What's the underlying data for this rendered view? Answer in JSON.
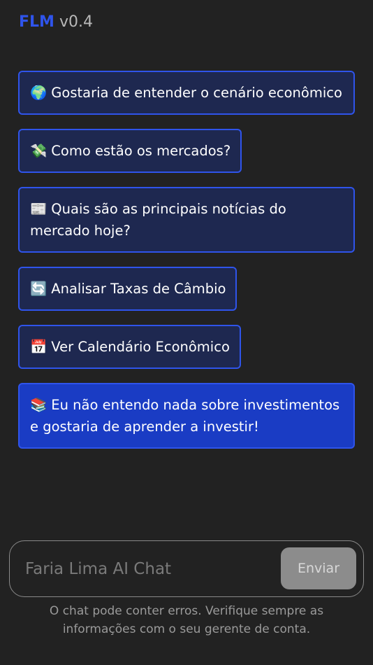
{
  "header": {
    "brand": "FLM",
    "version": "v0.4"
  },
  "suggestions": [
    {
      "emoji": "🌍",
      "label": "Gostaria de entender o cenário econômico"
    },
    {
      "emoji": "💸",
      "label": "Como estão os mercados?"
    },
    {
      "emoji": "📰",
      "label": "Quais são as principais notícias do mercado hoje?"
    },
    {
      "emoji": "🔄",
      "label": "Analisar Taxas de Câmbio"
    },
    {
      "emoji": "📅",
      "label": "Ver Calendário Econômico"
    },
    {
      "emoji": "📚",
      "label": "Eu não entendo nada sobre investimentos e gostaria de aprender a investir!"
    }
  ],
  "chat": {
    "placeholder": "Faria Lima AI Chat",
    "value": "",
    "send_label": "Enviar"
  },
  "disclaimer": "O chat pode conter erros. Verifique sempre as informações com o seu gerente de conta.",
  "colors": {
    "accent": "#2f54eb",
    "card_bg": "#1e2850",
    "card_primary_bg": "#1a3cc4",
    "background": "#222222",
    "send_button_bg": "#8c8c8c"
  }
}
